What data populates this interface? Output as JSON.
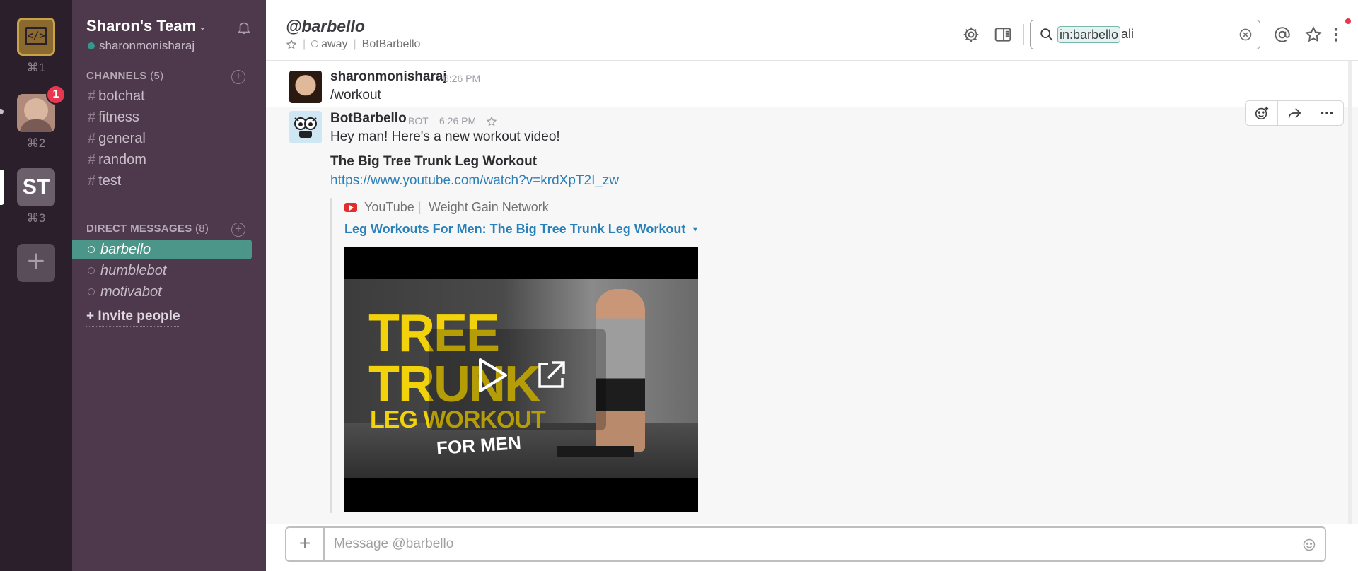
{
  "teams": {
    "team1": {
      "shortcut": "⌘1"
    },
    "team2": {
      "shortcut": "⌘2",
      "badge": "1"
    },
    "team3": {
      "initials": "ST",
      "shortcut": "⌘3"
    }
  },
  "sidebar": {
    "team_name": "Sharon's Team",
    "username": "sharonmonisharaj",
    "channels_header": "CHANNELS",
    "channels_count": "(5)",
    "channels": [
      "botchat",
      "fitness",
      "general",
      "random",
      "test"
    ],
    "dm_header": "DIRECT MESSAGES",
    "dm_count": "(8)",
    "direct_messages": [
      "barbello",
      "humblebot",
      "motivabot"
    ],
    "invite_label": "Invite people"
  },
  "header": {
    "channel_title": "@barbello",
    "status": "away",
    "real_name": "BotBarbello",
    "search_tag": "in:barbello",
    "search_query": "ali"
  },
  "messages": [
    {
      "author": "sharonmonisharaj",
      "time": "6:26 PM",
      "text": "/workout"
    },
    {
      "author": "BotBarbello",
      "bot_tag": "BOT",
      "time": "6:26 PM",
      "text": "Hey man! Here's a new workout video!",
      "bold_title": "The Big Tree Trunk Leg Workout",
      "link": "https://www.youtube.com/watch?v=krdXpT2I_zw",
      "attachment": {
        "service": "YouTube",
        "author": "Weight Gain Network",
        "title": "Leg Workouts For Men: The Big Tree Trunk Leg Workout",
        "thumbnail_text": [
          "TREE",
          "TRUNK",
          "LEG WORKOUT",
          "FOR MEN"
        ]
      }
    }
  ],
  "composer": {
    "placeholder": "Message @barbello"
  },
  "colors": {
    "rail": "#2a1f2a",
    "sidebar": "#4d394b",
    "active_item": "#4c9689",
    "link": "#2a80b9",
    "badge": "#e8384f"
  }
}
